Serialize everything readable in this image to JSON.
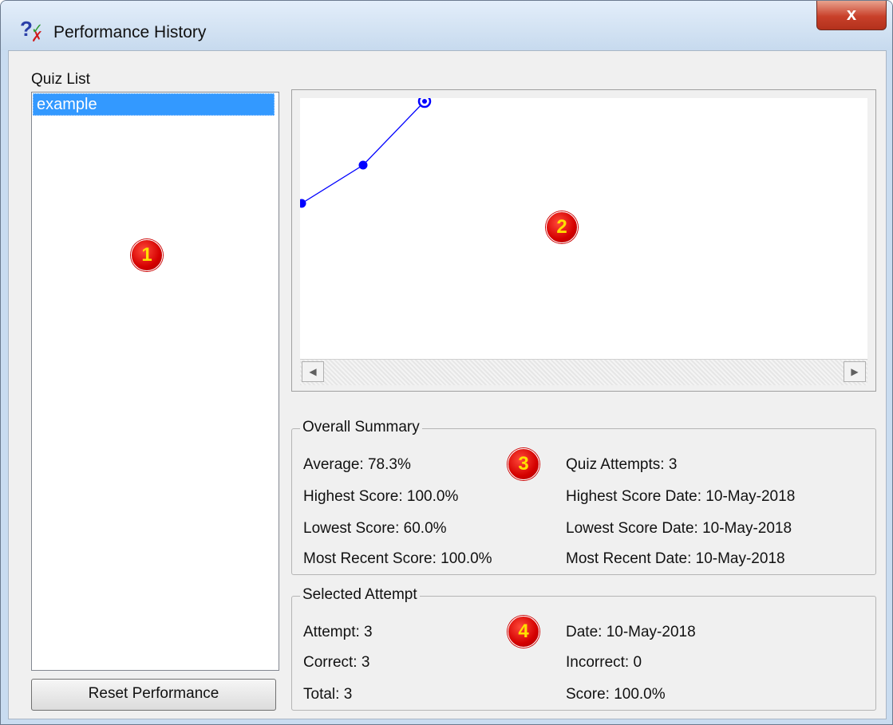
{
  "window": {
    "title": "Performance History",
    "close_label": "x"
  },
  "quiz_list": {
    "label": "Quiz List",
    "items": [
      "example"
    ],
    "selected_index": 0
  },
  "reset_button": "Reset Performance",
  "chart_data": {
    "type": "line",
    "x": [
      1,
      2,
      3
    ],
    "values": [
      60.0,
      75.0,
      100.0
    ],
    "ylim": [
      0,
      100
    ],
    "color": "#0000ff",
    "grid": false
  },
  "overall_summary": {
    "title": "Overall Summary",
    "average": "Average: 78.3%",
    "highest_score": "Highest Score: 100.0%",
    "lowest_score": "Lowest Score: 60.0%",
    "most_recent_score": "Most Recent Score: 100.0%",
    "quiz_attempts": "Quiz Attempts: 3",
    "highest_score_date": "Highest Score Date: 10-May-2018",
    "lowest_score_date": "Lowest Score Date: 10-May-2018",
    "most_recent_date": "Most Recent Date: 10-May-2018"
  },
  "selected_attempt": {
    "title": "Selected Attempt",
    "attempt": "Attempt: 3",
    "correct": "Correct: 3",
    "total": "Total: 3",
    "date": "Date: 10-May-2018",
    "incorrect": "Incorrect: 0",
    "score": "Score: 100.0%"
  },
  "markers": [
    "1",
    "2",
    "3",
    "4"
  ],
  "colors": {
    "selection": "#3399ff",
    "marker": "#d40000",
    "marker_text": "#ffe000",
    "chart_line": "#0000ff"
  }
}
